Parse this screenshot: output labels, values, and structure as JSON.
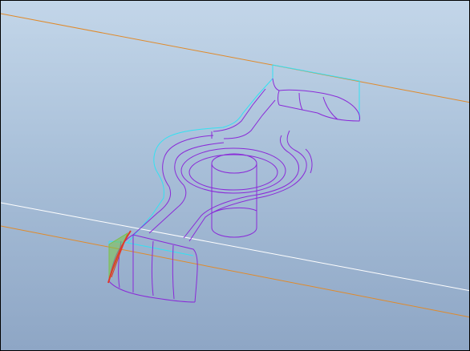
{
  "viewport": {
    "background_top": "#c3d6e9",
    "background_bottom": "#8ea6c5",
    "border_color": "#000000"
  },
  "colors": {
    "datum_plane": "#e08a2a",
    "reference_line": "#ffffff",
    "sketch_outline": "#33e1f2",
    "part_edges": "#8a2ad8",
    "selected_edge": "#e03a2a",
    "highlight_face": "#7cc24a"
  },
  "scene": {
    "icon": "cad-3d-wireframe",
    "description_visible": false
  }
}
